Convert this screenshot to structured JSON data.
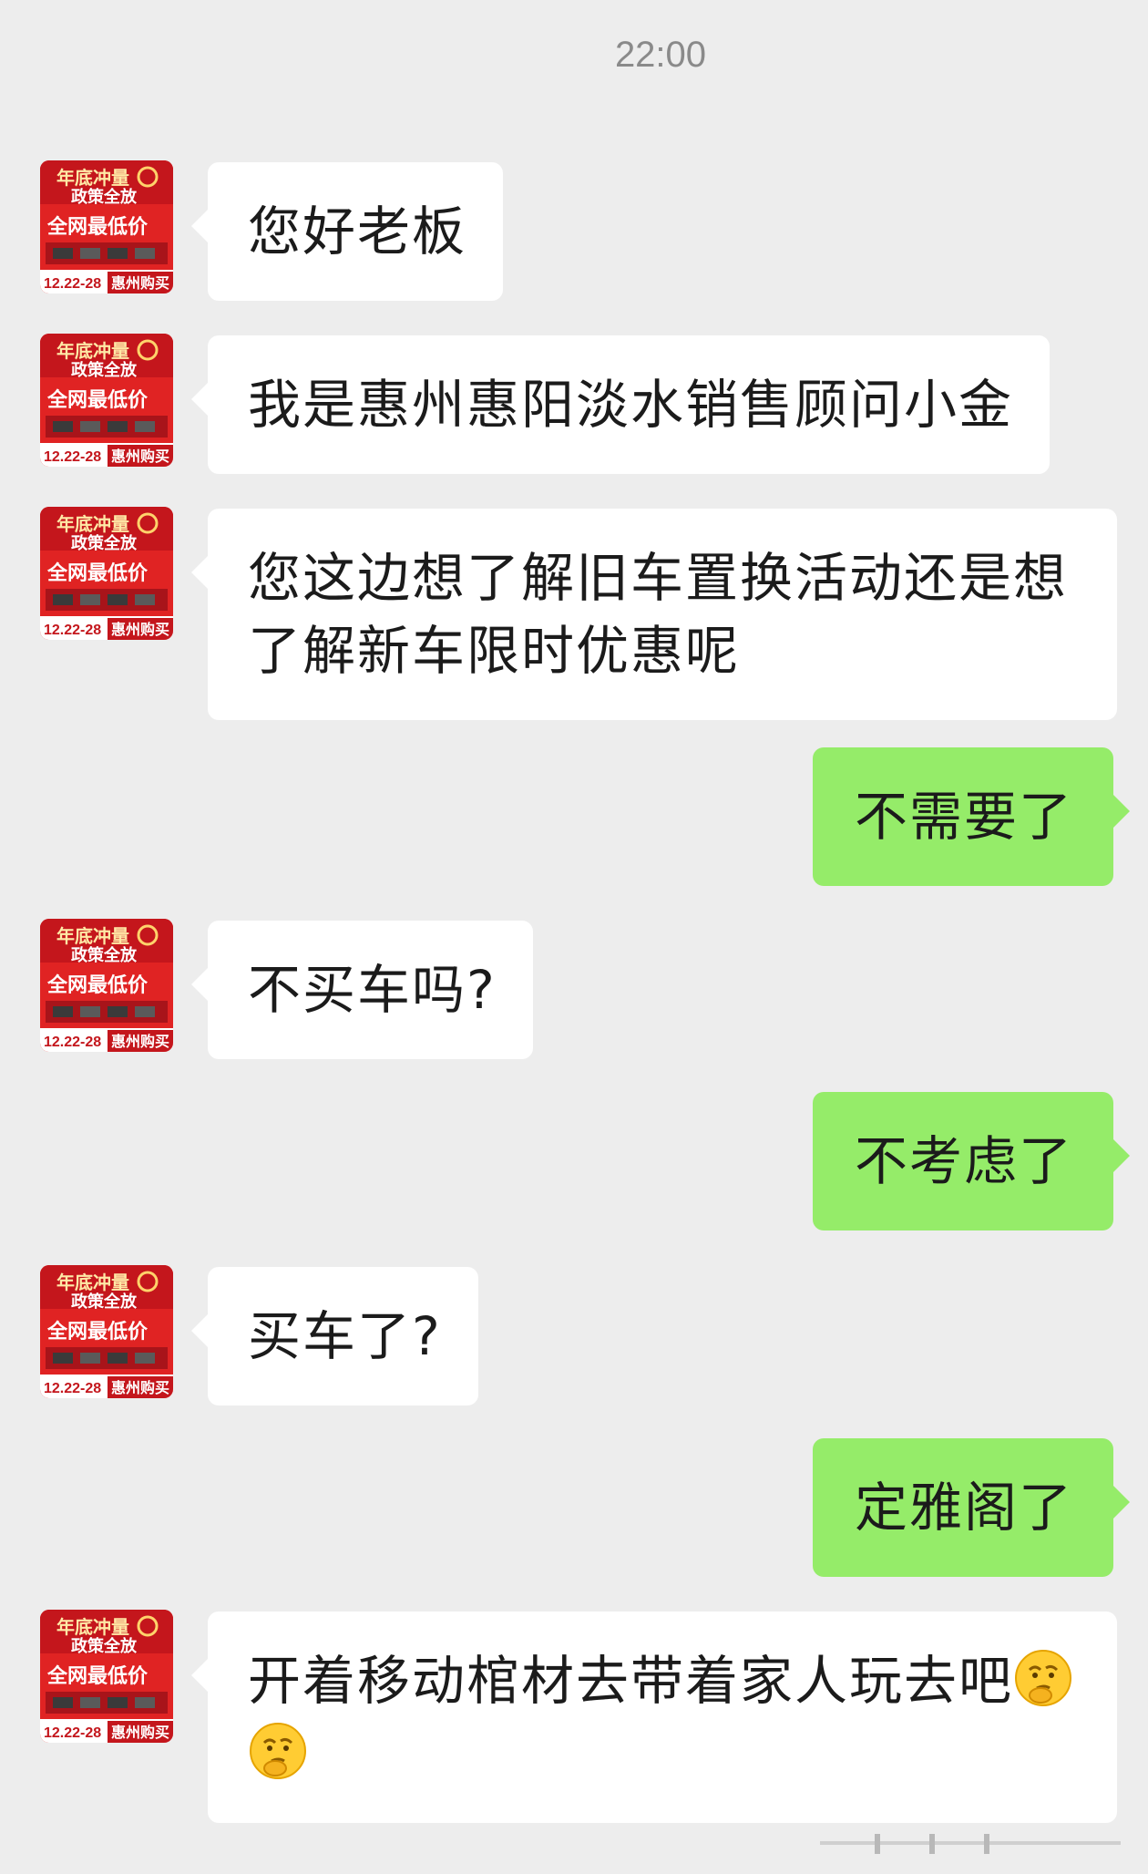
{
  "timestamp": "22:00",
  "avatar": {
    "line1": "年底冲量",
    "line2": "政策全放",
    "line3": "全网最低价",
    "date": "12.22-28",
    "place": "惠州购买",
    "bg_color": "#e02323"
  },
  "messages": [
    {
      "side": "in",
      "text": "您好老板"
    },
    {
      "side": "in",
      "text": "我是惠州惠阳淡水销售顾问小金"
    },
    {
      "side": "in",
      "text": "您这边想了解旧车置换活动还是想了解新车限时优惠呢"
    },
    {
      "side": "out",
      "text": "不需要了"
    },
    {
      "side": "in",
      "text": "不买车吗?"
    },
    {
      "side": "out",
      "text": "不考虑了"
    },
    {
      "side": "in",
      "text": "买车了?"
    },
    {
      "side": "out",
      "text": "定雅阁了"
    },
    {
      "side": "in",
      "text": "开着移动棺材去带着家人玩去吧",
      "emoji": "thinking-face-emoji x2"
    }
  ],
  "colors": {
    "background": "#ededed",
    "incoming_bubble": "#ffffff",
    "outgoing_bubble": "#95ec69",
    "timestamp": "#8a8a8a"
  }
}
